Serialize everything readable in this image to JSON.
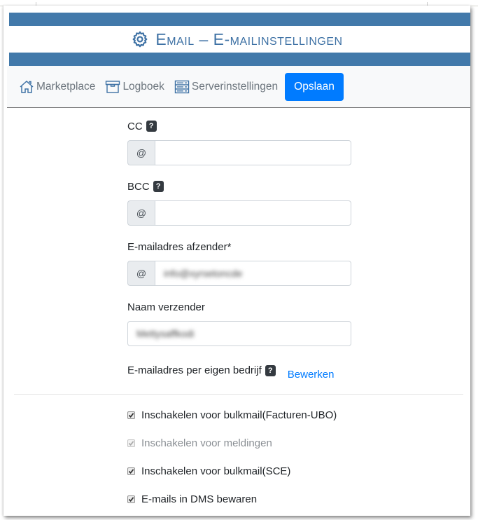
{
  "header": {
    "title": "Email – E-mailinstellingen",
    "icon": "gear-icon",
    "accent_color": "#4279aa"
  },
  "toolbar": {
    "items": [
      {
        "label": "Marketplace",
        "icon": "home-icon"
      },
      {
        "label": "Logboek",
        "icon": "archive-box-icon"
      },
      {
        "label": "Serverinstellingen",
        "icon": "server-icon"
      }
    ],
    "save_label": "Opslaan",
    "save_color": "#007bff"
  },
  "form": {
    "cc": {
      "label": "CC",
      "addon": "@",
      "value": "",
      "help": "?"
    },
    "bcc": {
      "label": "BCC",
      "addon": "@",
      "value": "",
      "help": "?"
    },
    "sender_email": {
      "label": "E-mailadres afzender*",
      "addon": "@",
      "value": "info@xyrsetoncde"
    },
    "sender_name": {
      "label": "Naam verzender",
      "value": "Mettysaffkodi"
    },
    "per_company": {
      "label": "E-mailadres per eigen bedrijf",
      "help": "?",
      "link": "Bewerken"
    }
  },
  "checkboxes": [
    {
      "label": "Inschakelen voor bulkmail(Facturen-UBO)",
      "checked": true,
      "disabled": false
    },
    {
      "label": "Inschakelen voor meldingen",
      "checked": true,
      "disabled": true
    },
    {
      "label": "Inschakelen voor bulkmail(SCE)",
      "checked": true,
      "disabled": false
    },
    {
      "label": "E-mails in DMS bewaren",
      "checked": true,
      "disabled": false
    }
  ]
}
